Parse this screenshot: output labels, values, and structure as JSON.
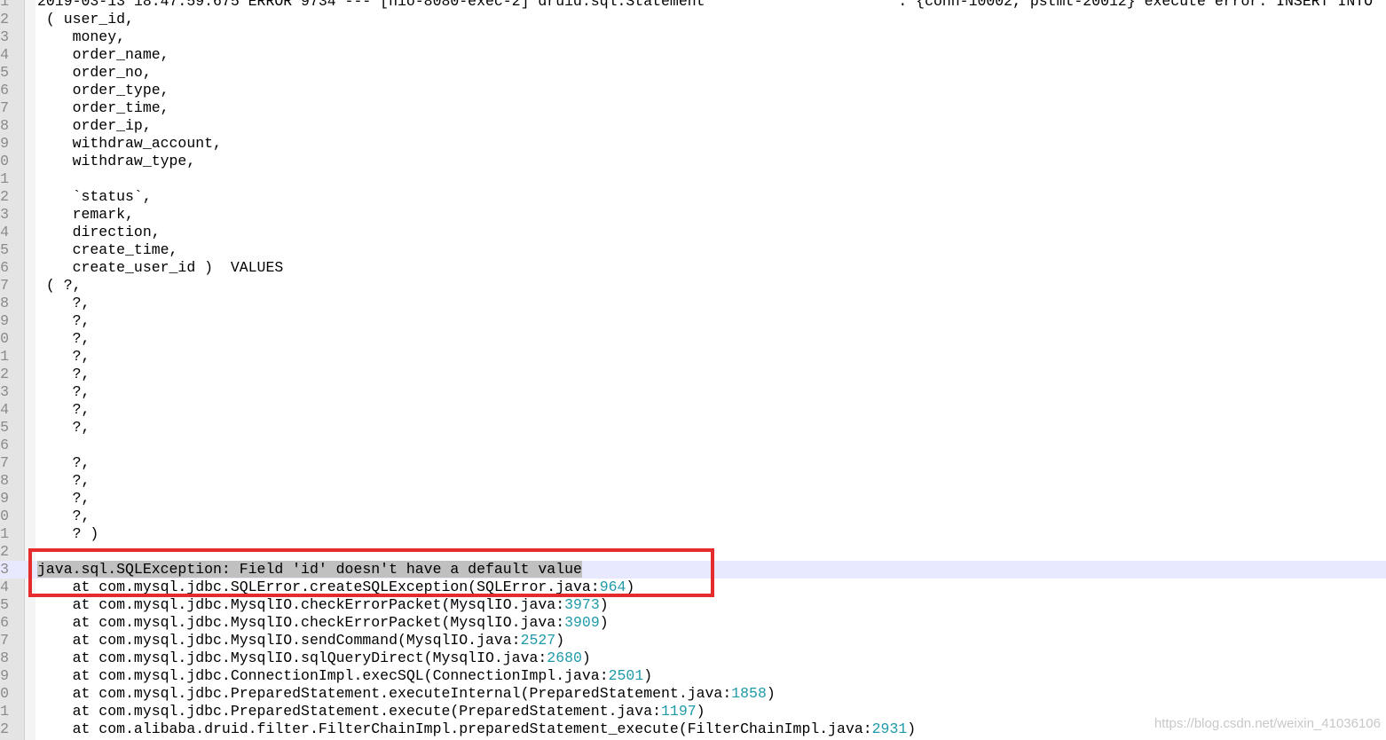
{
  "editor": {
    "line_numbers": [
      "1",
      "2",
      "3",
      "4",
      "5",
      "6",
      "7",
      "8",
      "9",
      "0",
      "1",
      "2",
      "3",
      "4",
      "5",
      "6",
      "7",
      "8",
      "9",
      "0",
      "1",
      "2",
      "3",
      "4",
      "5",
      "6",
      "7",
      "8",
      "9",
      "0",
      "1",
      "2",
      "3",
      "4",
      "5",
      "6",
      "7",
      "8",
      "9",
      "0",
      "1",
      "2"
    ],
    "lines": [
      "2019-03-13 18:47:59.675 ERROR 9734 --- [nio-8080-exec-2] druid.sql.Statement                      : {conn-10002, pstmt-20012} execute error. INSERT INTO",
      " ( user_id,",
      "    money,",
      "    order_name,",
      "    order_no,",
      "    order_type,",
      "    order_time,",
      "    order_ip,",
      "    withdraw_account,",
      "    withdraw_type,",
      "",
      "    `status`,",
      "    remark,",
      "    direction,",
      "    create_time,",
      "    create_user_id )  VALUES",
      " ( ?,",
      "    ?,",
      "    ?,",
      "    ?,",
      "    ?,",
      "    ?,",
      "    ?,",
      "    ?,",
      "    ?,",
      "",
      "    ?,",
      "    ?,",
      "    ?,",
      "    ?,",
      "    ? )",
      "",
      "java.sql.SQLException: Field 'id' doesn't have a default value",
      "    at com.mysql.jdbc.SQLError.createSQLException(SQLError.java:964)",
      "    at com.mysql.jdbc.MysqlIO.checkErrorPacket(MysqlIO.java:3973)",
      "    at com.mysql.jdbc.MysqlIO.checkErrorPacket(MysqlIO.java:3909)",
      "    at com.mysql.jdbc.MysqlIO.sendCommand(MysqlIO.java:2527)",
      "    at com.mysql.jdbc.MysqlIO.sqlQueryDirect(MysqlIO.java:2680)",
      "    at com.mysql.jdbc.ConnectionImpl.execSQL(ConnectionImpl.java:2501)",
      "    at com.mysql.jdbc.PreparedStatement.executeInternal(PreparedStatement.java:1858)",
      "    at com.mysql.jdbc.PreparedStatement.execute(PreparedStatement.java:1197)",
      "    at com.alibaba.druid.filter.FilterChainImpl.preparedStatement_execute(FilterChainImpl.java:2931)"
    ],
    "selected_line_index": 32
  },
  "watermark": "https://blog.csdn.net/weixin_41036106",
  "colors": {
    "highlight_box": "#e52b2b",
    "selection": "#c0c0c0",
    "current_line": "#e8e8ff"
  }
}
